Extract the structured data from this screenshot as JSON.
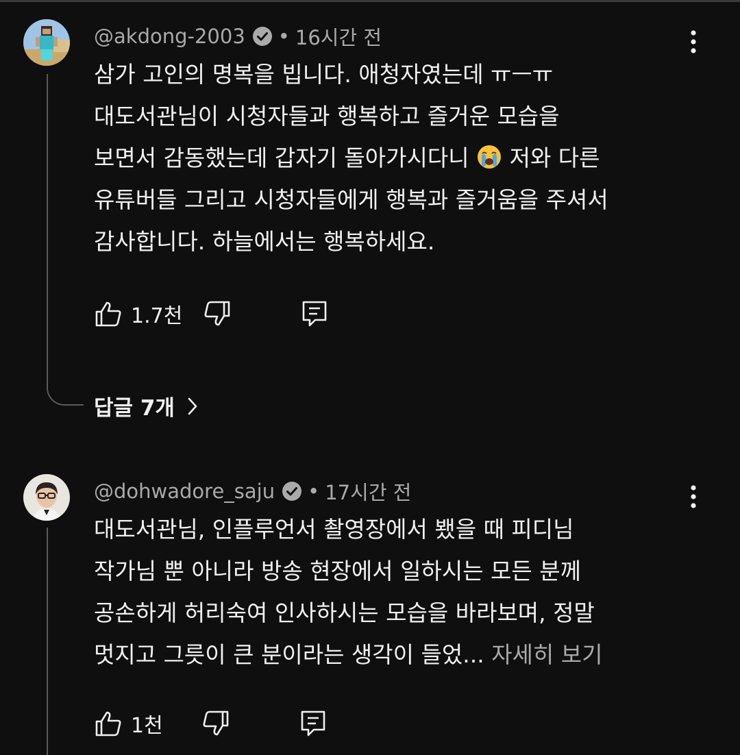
{
  "comments": [
    {
      "author": "@akdong-2003",
      "dot": "•",
      "time": "16시간 전",
      "lines": [
        "삼가 고인의 명복을 빕니다. 애청자였는데 ㅠㅡㅠ",
        "대도서관님이 시청자들과 행복하고 즐거운 모습을",
        "보면서 감동했는데 갑자기 돌아가시다니",
        "저와 다른",
        "유튜버들 그리고 시청자들에게 행복과 즐거움을 주셔서",
        "감사합니다. 하늘에서는 행복하세요."
      ],
      "likes": "1.7천",
      "replies": "답글 7개"
    },
    {
      "author": "@dohwadore_saju",
      "dot": "•",
      "time": "17시간 전",
      "lines": [
        "대도서관님, 인플루언서 촬영장에서 뵀을 때 피디님",
        "작가님 뿐 아니라 방송 현장에서 일하시는 모든 분께",
        "공손하게 허리숙여 인사하시는 모습을 바라보며, 정말",
        "멋지고 그릇이 큰 분이라는 생각이 들었..."
      ],
      "more": "자세히 보기",
      "likes": "1천"
    }
  ],
  "icons": [
    "verified-icon",
    "more-vert-icon",
    "like-icon",
    "dislike-icon",
    "reply-icon",
    "crying-face-emoji",
    "chevron-right-icon"
  ],
  "colors": {
    "background": "#0f0f0f",
    "text": "#f1f1f1",
    "secondary": "#aaaaaa",
    "thread": "#5a5a5a"
  }
}
